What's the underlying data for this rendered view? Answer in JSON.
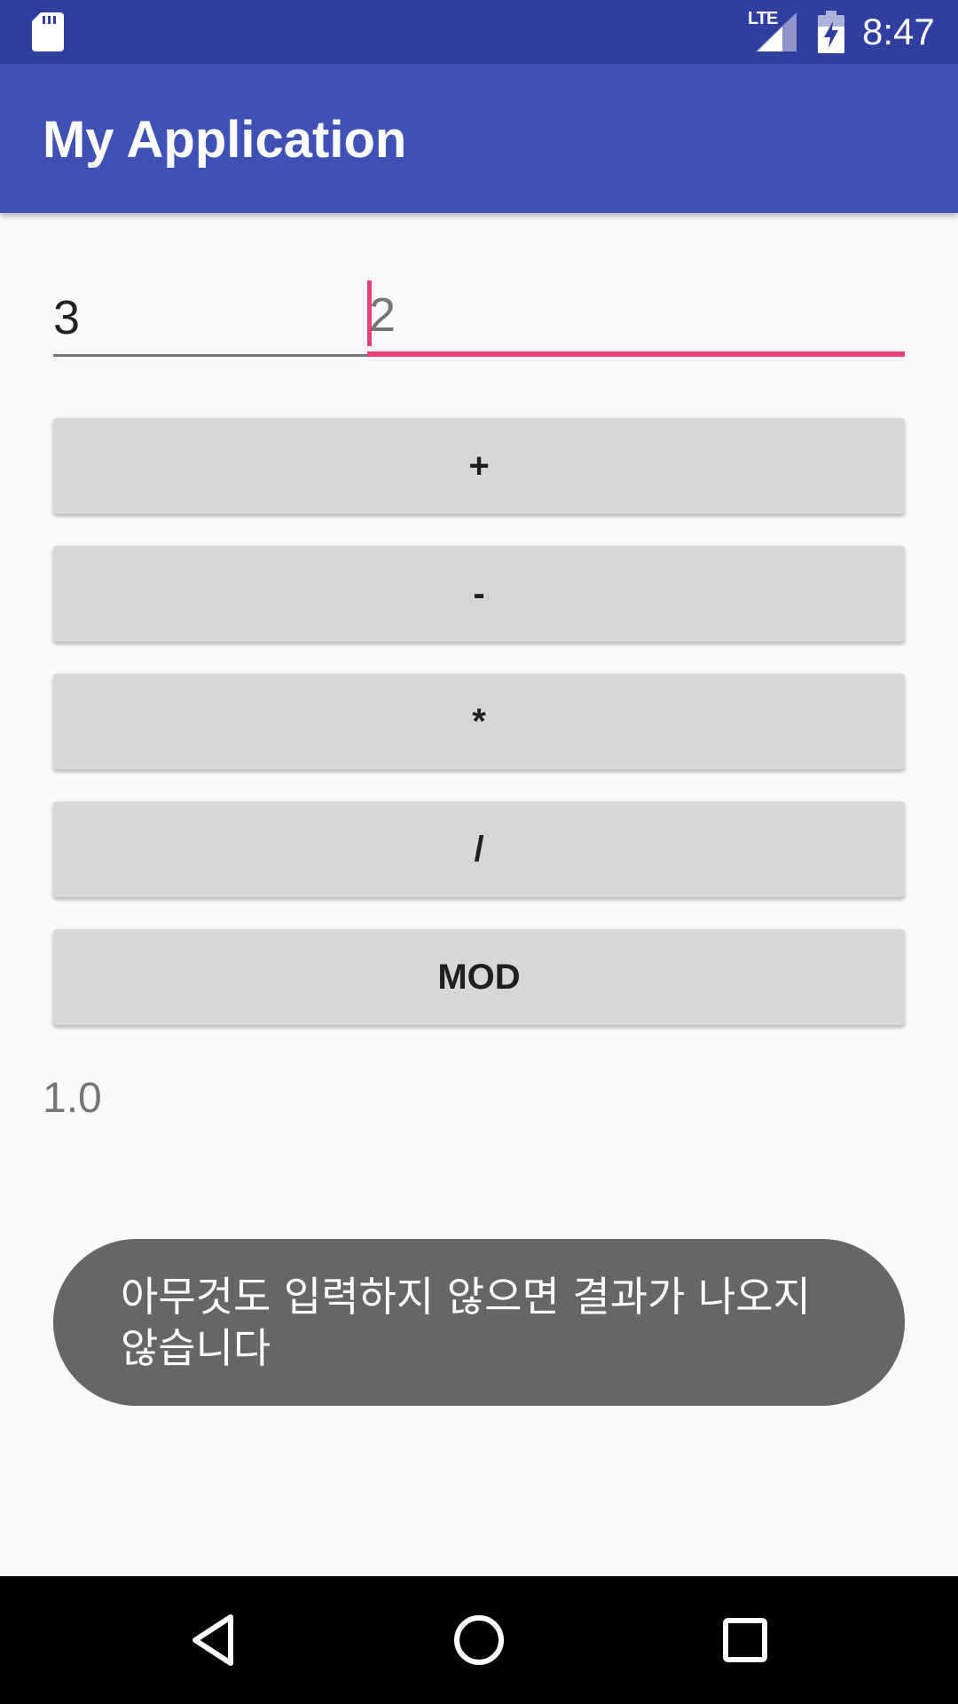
{
  "status_bar": {
    "network": "LTE",
    "time": "8:47",
    "icons": [
      "sd-card-icon",
      "signal-icon",
      "battery-charging-icon"
    ]
  },
  "app_bar": {
    "title": "My Application"
  },
  "inputs": {
    "first": {
      "value": "3"
    },
    "second": {
      "value": "2",
      "focused": true
    }
  },
  "buttons": [
    {
      "label": "+"
    },
    {
      "label": "-"
    },
    {
      "label": "*"
    },
    {
      "label": "/"
    },
    {
      "label": "MOD"
    }
  ],
  "result": "1.0",
  "toast": {
    "message": "아무것도 입력하지 않으면 결과가 나오지 않습니다"
  },
  "colors": {
    "status_bar": "#303f9f",
    "primary": "#3f51b5",
    "accent": "#ec407a",
    "button": "#d6d7d7",
    "toast": "#666666"
  },
  "nav_bar": {
    "icons": [
      "back-icon",
      "home-icon",
      "recents-icon"
    ]
  }
}
